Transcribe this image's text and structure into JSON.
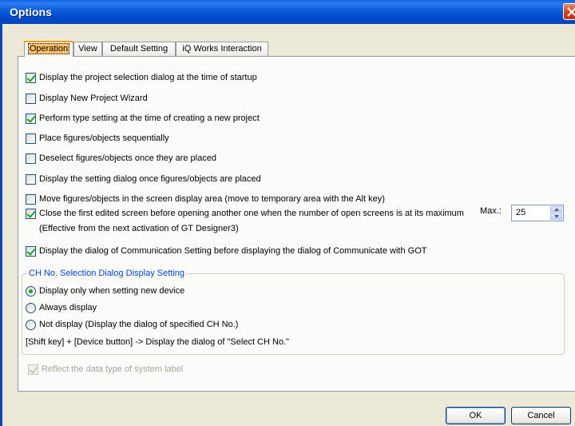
{
  "window": {
    "title": "Options"
  },
  "tabs": [
    {
      "label": "Operation",
      "active": true
    },
    {
      "label": "View",
      "active": false
    },
    {
      "label": "Default Setting",
      "active": false
    },
    {
      "label": "iQ Works Interaction",
      "active": false
    }
  ],
  "options": [
    {
      "label": "Display the project selection dialog at the time of startup",
      "checked": true
    },
    {
      "label": "Display New Project Wizard",
      "checked": false
    },
    {
      "label": "Perform type setting at the time of creating a new project",
      "checked": true
    },
    {
      "label": "Place figures/objects sequentially",
      "checked": false
    },
    {
      "label": "Deselect figures/objects once they are placed",
      "checked": false
    },
    {
      "label": "Display the setting dialog once figures/objects are placed",
      "checked": false
    },
    {
      "label": "Move figures/objects in the screen display area (move to temporary area with the Alt key)",
      "checked": false
    },
    {
      "label": "Close the first edited screen before opening another one when the number of open screens is at its maximum",
      "checked": true
    },
    {
      "label": "Display the dialog of Communication Setting before displaying the dialog of Communicate with GOT",
      "checked": true
    }
  ],
  "max_screens": {
    "label": "Max.:",
    "value": "25"
  },
  "note_effective": "(Effective from the next activation of GT Designer3)",
  "ch_group": {
    "legend": "CH No. Selection Dialog Display Setting",
    "radios": [
      {
        "label": "Display only when setting new device",
        "selected": true
      },
      {
        "label": "Always display",
        "selected": false
      },
      {
        "label": "Not display (Display the dialog of specified CH No.)",
        "selected": false
      }
    ],
    "hint": "[Shift key] + [Device button] -> Display the dialog of \"Select CH No.\""
  },
  "reflect_label": {
    "label": "Reflect the data type of system label",
    "checked": true,
    "enabled": false
  },
  "buttons": {
    "ok": "OK",
    "cancel": "Cancel"
  },
  "colors": {
    "titlebar": "#0a5fdc",
    "active_tab_accent": "#e6a01a",
    "group_legend": "#0046d5",
    "check_mark": "#21a121"
  }
}
